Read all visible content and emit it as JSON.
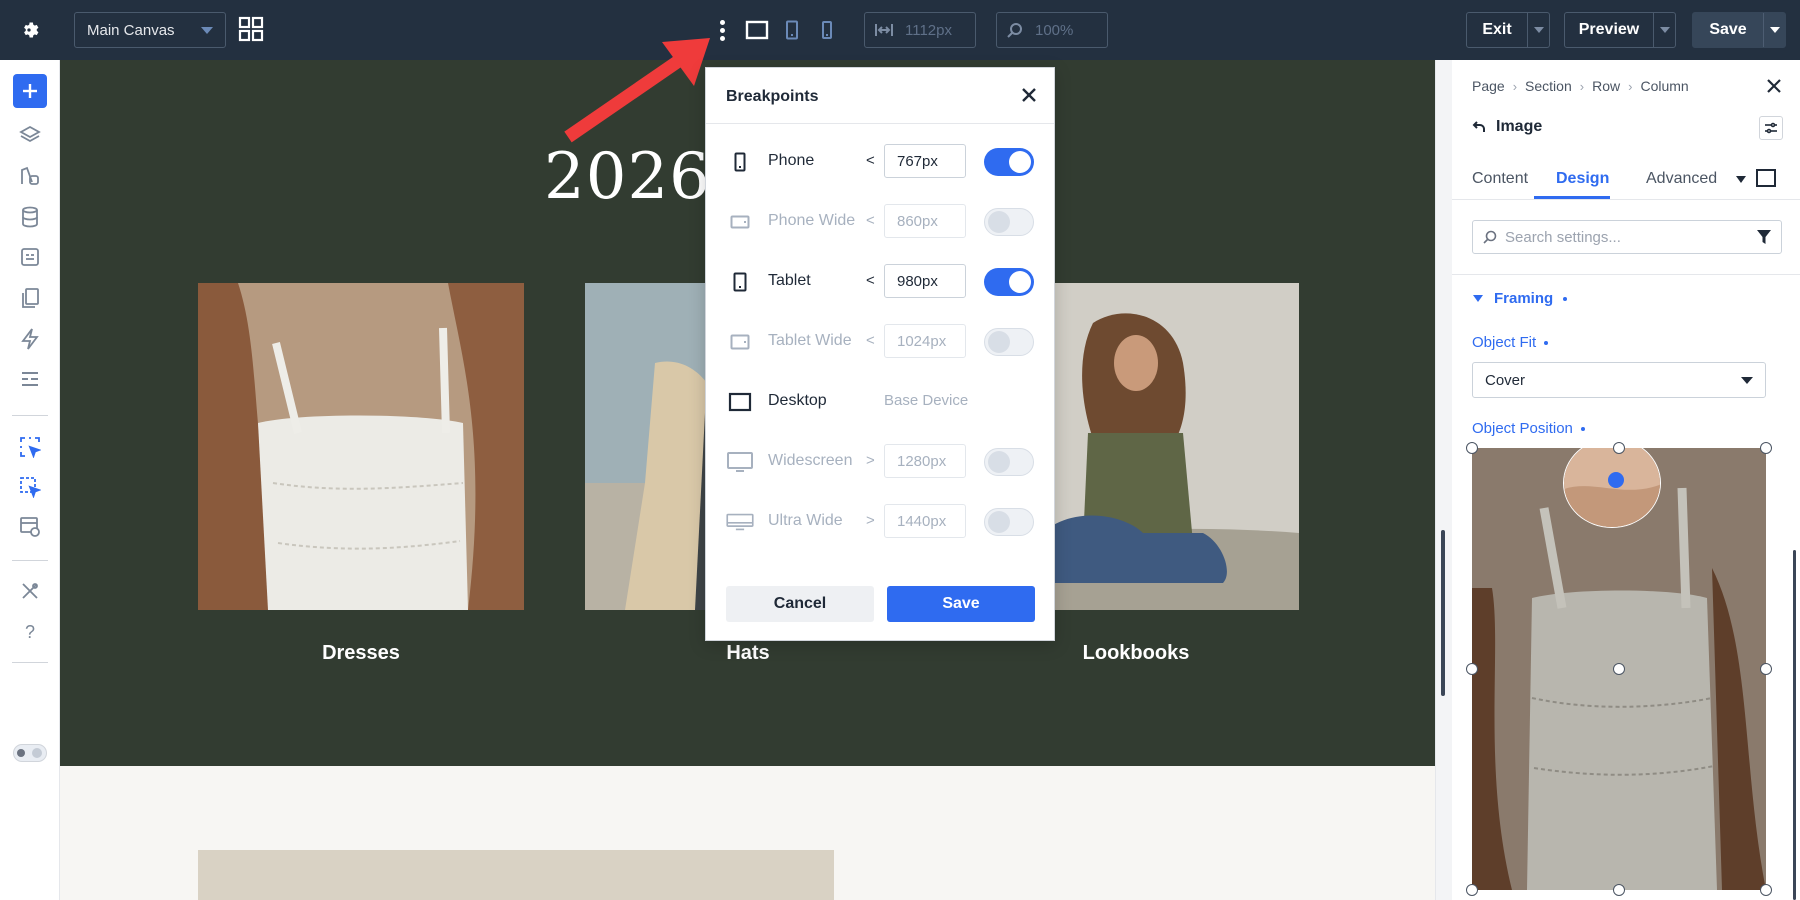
{
  "topbar": {
    "canvas_select": "Main Canvas",
    "width_value": "1112px",
    "zoom_value": "100%",
    "exit_label": "Exit",
    "preview_label": "Preview",
    "save_label": "Save"
  },
  "canvas": {
    "hero_title": "2026 C",
    "cards": [
      {
        "label": "Dresses"
      },
      {
        "label": "Hats"
      },
      {
        "label": "Lookbooks"
      }
    ]
  },
  "breakpoints_modal": {
    "title": "Breakpoints",
    "rows": [
      {
        "name": "Phone",
        "op": "<",
        "value": "767px",
        "enabled": true,
        "icon": "phone-icon"
      },
      {
        "name": "Phone Wide",
        "op": "<",
        "value": "860px",
        "enabled": false,
        "icon": "phone-wide-icon"
      },
      {
        "name": "Tablet",
        "op": "<",
        "value": "980px",
        "enabled": true,
        "icon": "tablet-icon"
      },
      {
        "name": "Tablet Wide",
        "op": "<",
        "value": "1024px",
        "enabled": false,
        "icon": "tablet-wide-icon"
      },
      {
        "name": "Desktop",
        "base_label": "Base Device",
        "icon": "desktop-icon"
      },
      {
        "name": "Widescreen",
        "op": ">",
        "value": "1280px",
        "enabled": false,
        "icon": "widescreen-icon"
      },
      {
        "name": "Ultra Wide",
        "op": ">",
        "value": "1440px",
        "enabled": false,
        "icon": "ultrawide-icon"
      }
    ],
    "cancel_label": "Cancel",
    "save_label": "Save"
  },
  "right_panel": {
    "breadcrumb": [
      "Page",
      "Section",
      "Row",
      "Column"
    ],
    "element_title": "Image",
    "tabs": [
      "Content",
      "Design",
      "Advanced"
    ],
    "active_tab": "Design",
    "search_placeholder": "Search settings...",
    "section_title": "Framing",
    "object_fit_label": "Object Fit",
    "object_fit_value": "Cover",
    "object_position_label": "Object Position"
  },
  "colors": {
    "topbar_bg": "#233040",
    "accent": "#2f6bf0",
    "hero_bg": "#323c31",
    "arrow": "#ef3b3b"
  }
}
